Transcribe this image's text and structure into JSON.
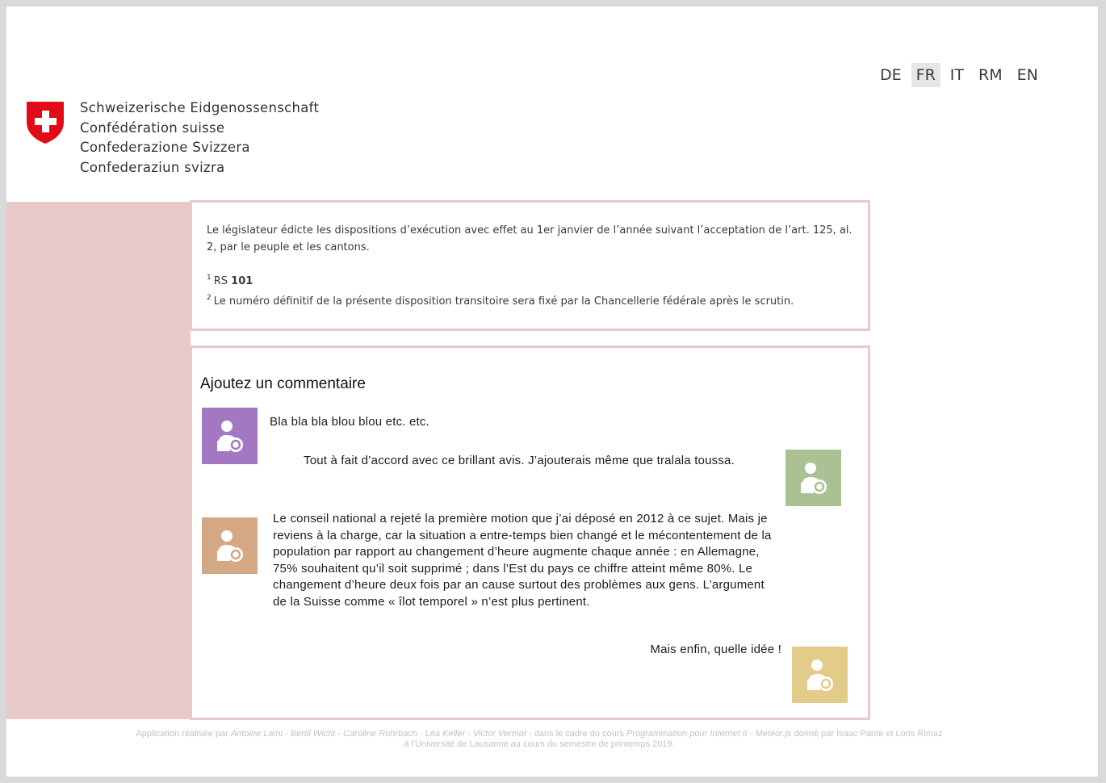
{
  "languages": [
    {
      "code": "DE",
      "active": false
    },
    {
      "code": "FR",
      "active": true
    },
    {
      "code": "IT",
      "active": false
    },
    {
      "code": "RM",
      "active": false
    },
    {
      "code": "EN",
      "active": false
    }
  ],
  "org": {
    "lines": [
      "Schweizerische Eidgenossenschaft",
      "Confédération suisse",
      "Confederazione Svizzera",
      "Confederaziun svizra"
    ]
  },
  "law": {
    "paragraph": "Le législateur édicte les dispositions d’exécution avec effet au 1er janvier de l’année suivant l’acceptation de l’art. 125, al. 2, par le peuple et les cantons.",
    "note1_num": "1",
    "note1_prefix": "RS ",
    "note1_bold": "101",
    "note2_num": "2",
    "note2_text": "Le numéro définitif de la présente disposition transitoire sera fixé par la Chancellerie fédérale après le scrutin."
  },
  "comments": {
    "heading": "Ajoutez un commentaire",
    "items": [
      {
        "text": "Bla bla bla blou blou etc. etc.",
        "avatar_color": "#a178c1",
        "avatar_side": "left"
      },
      {
        "text": "Tout à fait d’accord avec ce brillant avis. J’ajouterais même que tralala toussa.",
        "avatar_color": "#a9c193",
        "avatar_side": "right"
      },
      {
        "text": "Le conseil national a rejeté la première motion que j’ai déposé en 2012 à ce sujet. Mais  je reviens à la charge, car la situation a entre-temps bien changé et le mécontentement de la population par rapport au changement d’heure augmente chaque année : en Allemagne, 75% souhaitent qu’il soit supprimé ; dans l’Est du pays ce chiffre atteint même 80%. Le changement d’heure deux fois par an cause surtout des problèmes aux gens. L’argument de la Suisse comme « îlot temporel » n’est plus pertinent.",
        "avatar_color": "#d4a785",
        "avatar_side": "left"
      },
      {
        "text": "Mais enfin, quelle idée !",
        "avatar_color": "#e3cc8a",
        "avatar_side": "right"
      }
    ]
  },
  "footer": {
    "prefix": "Application réalisée par ",
    "authors": "Antoine Lami - Bertil Wicht - Caroline Rohrbach - Léa Keller - Victor Vermot",
    "middle": " - dans le cadre du cours ",
    "course": "Programmation pour Internet II - Meteor.js",
    "suffix": " donné par Isaac Pante et Loris Rimaz à l'Université de Lausanne au cours du semestre de printemps 2019."
  }
}
